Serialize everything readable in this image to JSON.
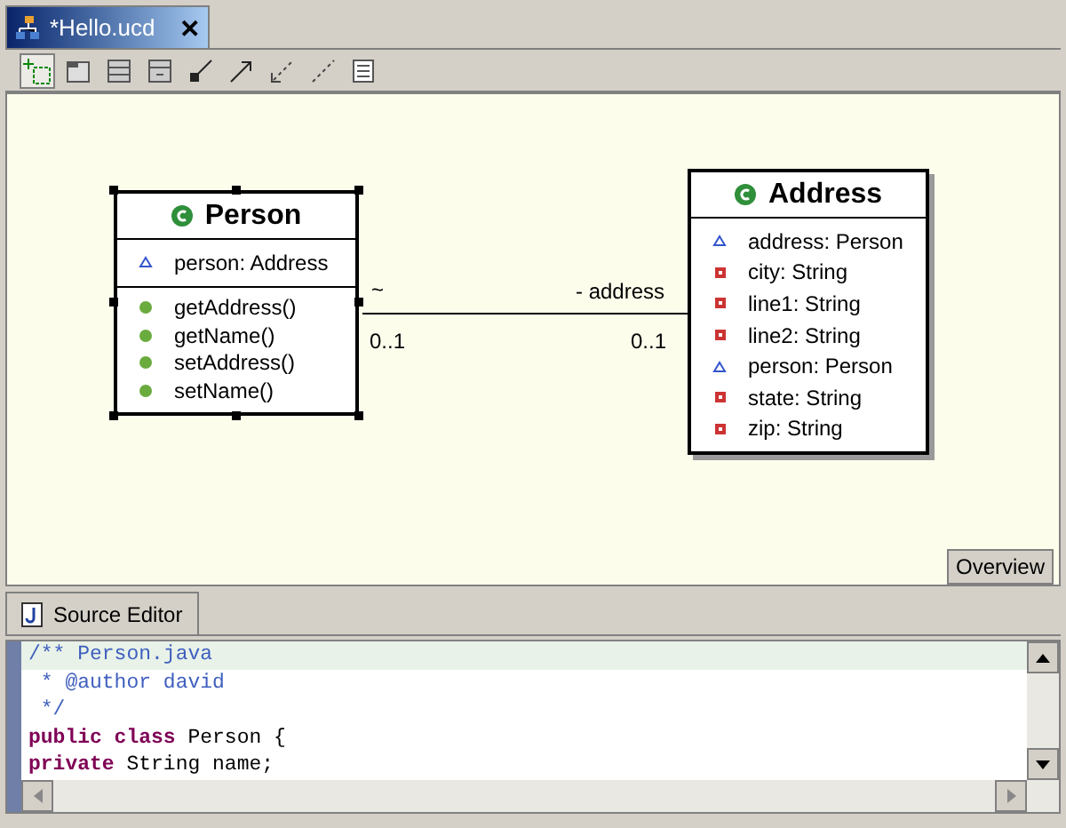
{
  "editor_tab": {
    "title": "*Hello.ucd",
    "close": "✕"
  },
  "toolbar": [
    {
      "selected": true
    },
    {
      "selected": false
    },
    {
      "selected": false
    },
    {
      "selected": false
    },
    {
      "selected": false
    },
    {
      "selected": false
    },
    {
      "selected": false
    },
    {
      "selected": false
    },
    {
      "selected": false
    }
  ],
  "classes": [
    {
      "name": "Person",
      "selected": true,
      "attributes": [
        {
          "text": "person: Address",
          "kind": "package"
        }
      ],
      "methods": [
        {
          "text": "getAddress()"
        },
        {
          "text": "getName()"
        },
        {
          "text": "setAddress()"
        },
        {
          "text": "setName()"
        }
      ]
    },
    {
      "name": "Address",
      "selected": false,
      "attributes": [
        {
          "text": "address: Person",
          "kind": "package"
        },
        {
          "text": "city: String",
          "kind": "private"
        },
        {
          "text": "line1: String",
          "kind": "private"
        },
        {
          "text": "line2: String",
          "kind": "private"
        },
        {
          "text": "person: Person",
          "kind": "package"
        },
        {
          "text": "state: String",
          "kind": "private"
        },
        {
          "text": "zip: String",
          "kind": "private"
        }
      ]
    }
  ],
  "association": {
    "source_role": "~",
    "source_multiplicity": "0..1",
    "target_role": "- address",
    "target_multiplicity": "0..1"
  },
  "overview_button": "Overview",
  "source_tab": {
    "title": "Source Editor"
  },
  "code_lines": [
    {
      "current": true,
      "tokens": [
        {
          "text": "/** Person.java",
          "kind": "comment"
        }
      ]
    },
    {
      "current": false,
      "tokens": [
        {
          "text": " * @author david",
          "kind": "comment"
        }
      ]
    },
    {
      "current": false,
      "tokens": [
        {
          "text": " */",
          "kind": "comment"
        }
      ]
    },
    {
      "current": false,
      "tokens": [
        {
          "text": "public class",
          "kind": "keyword"
        },
        {
          "text": " Person {",
          "kind": "plain"
        }
      ]
    },
    {
      "current": false,
      "tokens": [
        {
          "text": "private",
          "kind": "keyword"
        },
        {
          "text": " String name;",
          "kind": "plain"
        }
      ]
    }
  ]
}
